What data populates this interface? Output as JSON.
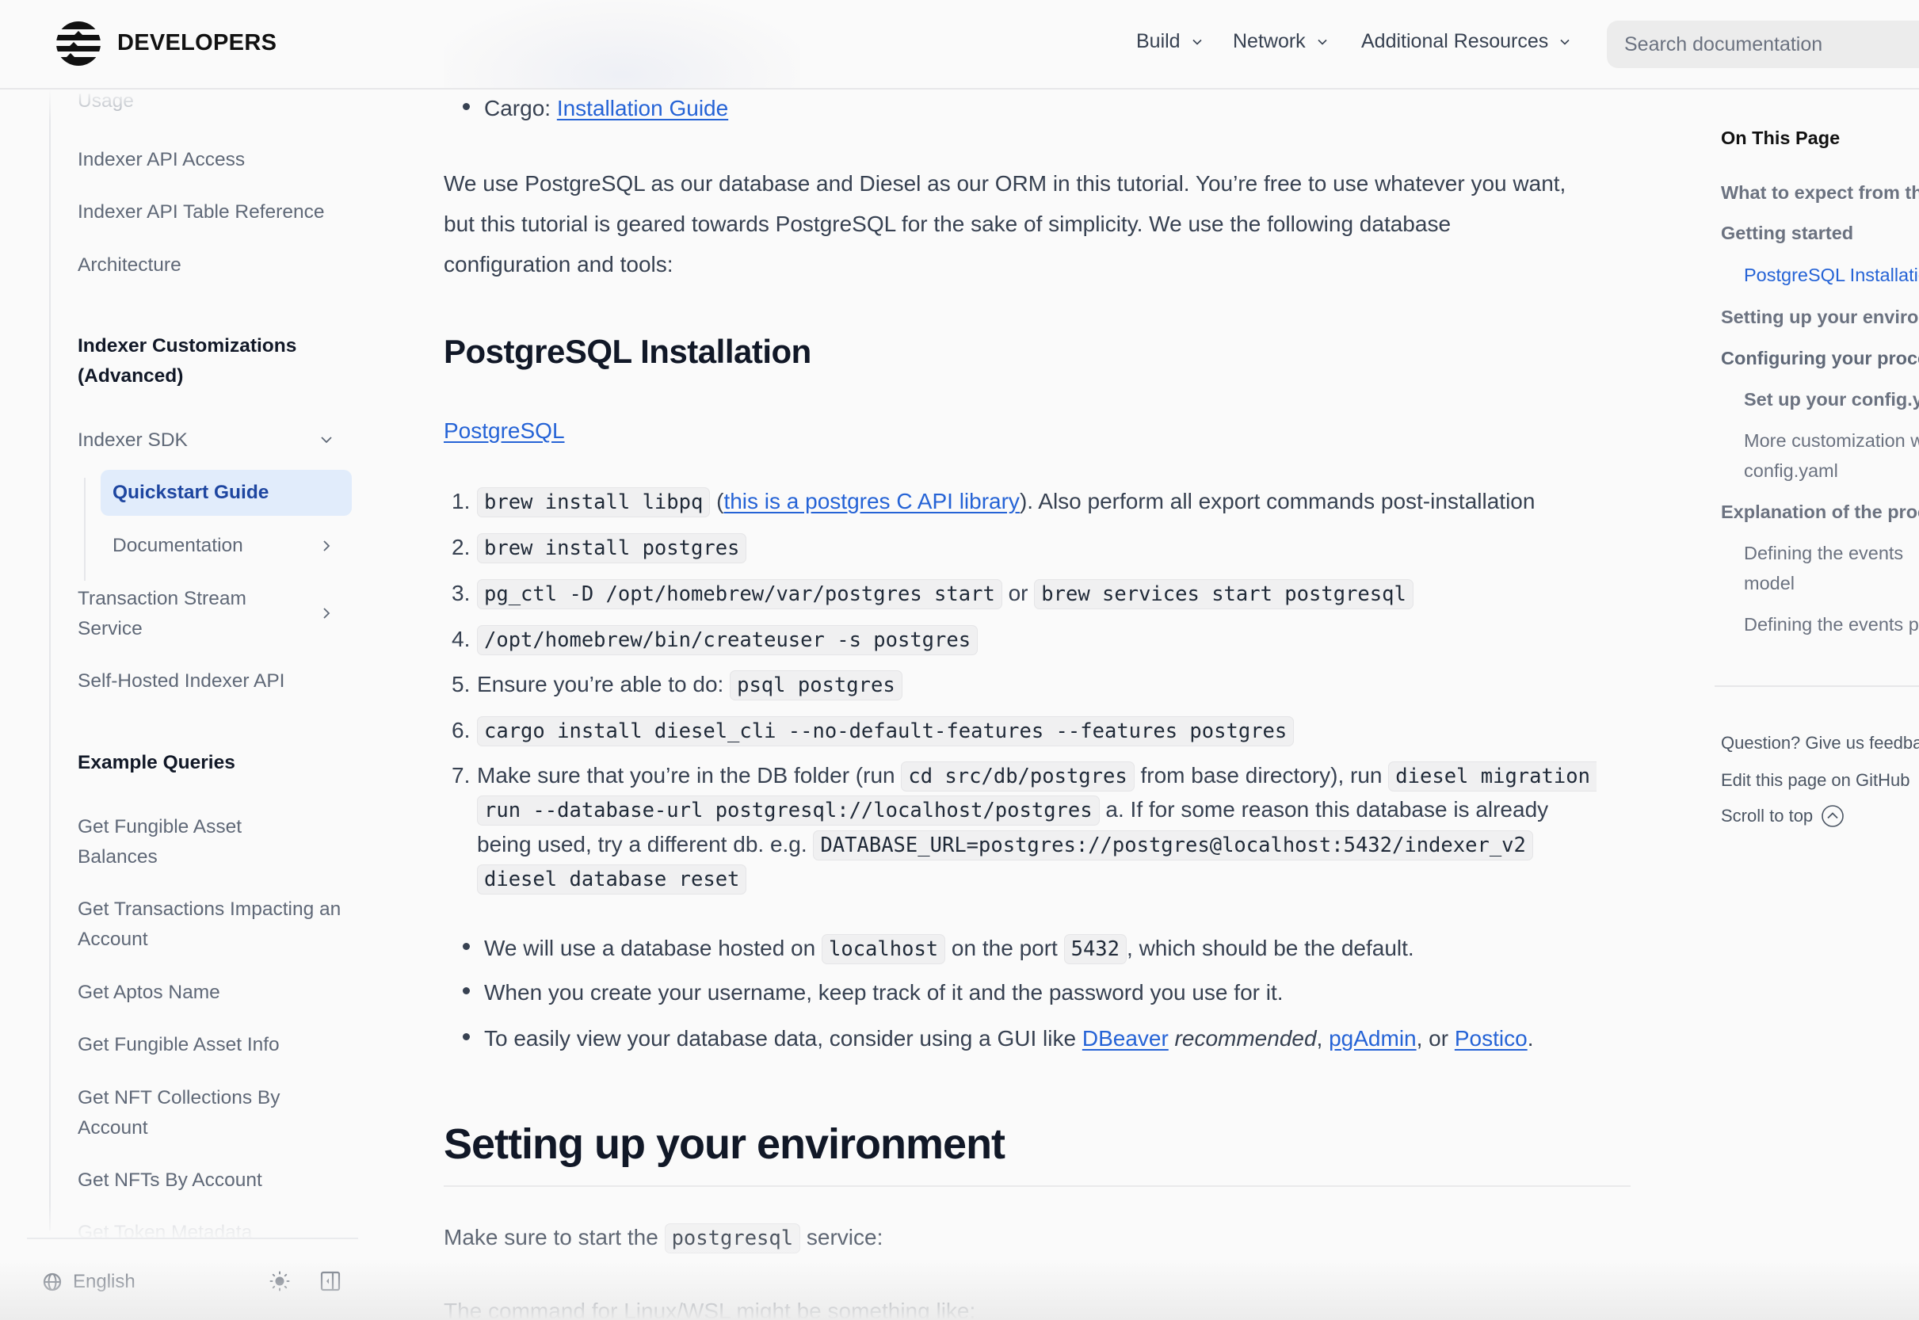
{
  "header": {
    "brand": "DEVELOPERS",
    "logo_icon": "aptos-logo-icon",
    "nav": [
      {
        "label": "Build",
        "icon": "chevron-down-icon"
      },
      {
        "label": "Network",
        "icon": "chevron-down-icon"
      },
      {
        "label": "Additional Resources",
        "icon": "chevron-down-icon"
      }
    ],
    "search": {
      "placeholder": "Search documentation",
      "value": ""
    }
  },
  "sidebar": {
    "items": [
      {
        "label": "Usage",
        "faded": true
      },
      {
        "label": "Indexer API Access"
      },
      {
        "label": "Indexer API Table Reference"
      },
      {
        "label": "Architecture"
      }
    ],
    "section_customizations": "Indexer Customizations (Advanced)",
    "indexer_sdk": {
      "label": "Indexer SDK",
      "icon": "chevron-down-icon",
      "expanded": true
    },
    "indexer_sdk_children": [
      {
        "label": "Quickstart Guide",
        "active": true
      },
      {
        "label": "Documentation",
        "icon": "chevron-right-icon"
      }
    ],
    "transaction_stream": {
      "label": "Transaction Stream Service",
      "icon": "chevron-right-icon"
    },
    "self_hosted": {
      "label": "Self-Hosted Indexer API"
    },
    "section_examples": "Example Queries",
    "examples": [
      {
        "label": "Get Fungible Asset Balances"
      },
      {
        "label": "Get Transactions Impacting an Account"
      },
      {
        "label": "Get Aptos Name"
      },
      {
        "label": "Get Fungible Asset Info"
      },
      {
        "label": "Get NFT Collections By Account"
      },
      {
        "label": "Get NFTs By Account"
      },
      {
        "label": "Get Token Metadata",
        "faded": true
      }
    ],
    "footer": {
      "language": "English",
      "language_icon": "globe-icon",
      "theme_icon": "sun-icon",
      "collapse_icon": "sidebar-collapse-icon"
    }
  },
  "main": {
    "cargo": {
      "prefix": "Cargo: ",
      "link": "Installation Guide"
    },
    "intro_lines": [
      "We use PostgreSQL as our database and Diesel as our ORM in this tutorial. You’re free to use whatever you want,",
      "but this tutorial is geared towards PostgreSQL for the sake of simplicity. We use the following database",
      "configuration and tools:"
    ],
    "h2_postgres": "PostgreSQL Installation",
    "postgres_link": "PostgreSQL",
    "steps": {
      "s1": {
        "num": "1.",
        "code": "brew install libpq",
        "open": " (",
        "link": "this is a postgres C API library",
        "rest": "). Also perform all export commands post-installation"
      },
      "s2": {
        "num": "2.",
        "code": "brew install postgres"
      },
      "s3": {
        "num": "3.",
        "code": "pg_ctl -D /opt/homebrew/var/postgres start",
        "mid": " or ",
        "code2": "brew services start postgresql"
      },
      "s4": {
        "num": "4.",
        "code": "/opt/homebrew/bin/createuser -s postgres"
      },
      "s5": {
        "num": "5.",
        "text": "Ensure you’re able to do: ",
        "code": "psql postgres"
      },
      "s6": {
        "num": "6.",
        "code": "cargo install diesel_cli --no-default-features --features postgres"
      },
      "s7": {
        "num": "7.",
        "text1": "Make sure that you’re in the DB folder (run ",
        "code1": "cd src/db/postgres",
        "text2": " from base directory), run ",
        "code2a": "diesel migration",
        "code2b": "run --database-url postgresql://localhost/postgres",
        "text3": " a. If for some reason this database is already",
        "text4": "being used, try a different db. e.g. ",
        "code3": "DATABASE_URL=postgres://postgres@localhost:5432/indexer_v2",
        "code4": "diesel database reset"
      }
    },
    "bullets": {
      "b1": {
        "text1": "We will use a database hosted on ",
        "code1": "localhost",
        "text2": " on the port ",
        "code2": "5432",
        "text3": ", which should be the default."
      },
      "b2": {
        "text": "When you create your username, keep track of it and the password you use for it."
      },
      "b3": {
        "text1": "To easily view your database data, consider using a GUI like ",
        "link1": "DBeaver",
        "em": " recommended",
        "sep1": ", ",
        "link2": "pgAdmin",
        "sep2": ", or ",
        "link3": "Postico",
        "end": "."
      }
    },
    "h1_env": "Setting up your environment",
    "env_line": {
      "text1": "Make sure to start the ",
      "code": "postgresql",
      "text2": " service:"
    },
    "linux_line": "The command for Linux/WSL might be something like:"
  },
  "toc": {
    "title": "On This Page",
    "items": [
      {
        "label": "What to expect from this tutorial"
      },
      {
        "label": "Getting started"
      },
      {
        "label": "PostgreSQL Installation",
        "active": true
      },
      {
        "label": "Setting up your environment"
      },
      {
        "label": "Configuring your processor"
      },
      {
        "label": "Set up your config.yaml"
      },
      {
        "label": "More customization with",
        "label2": "config.yaml"
      },
      {
        "label": "Explanation of the processor"
      },
      {
        "label": "Defining the events",
        "label2": "model"
      },
      {
        "label": "Defining the events processor"
      }
    ],
    "links": {
      "feedback": "Question? Give us feedback",
      "edit": "Edit this page on GitHub",
      "scroll_top": "Scroll to top",
      "scroll_icon": "arrow-up-circle-icon"
    }
  },
  "colors": {
    "accent": "#2563d6",
    "active_bg": "#e1ecfb",
    "active_text": "#1e46a0",
    "background": "#fafafa"
  }
}
